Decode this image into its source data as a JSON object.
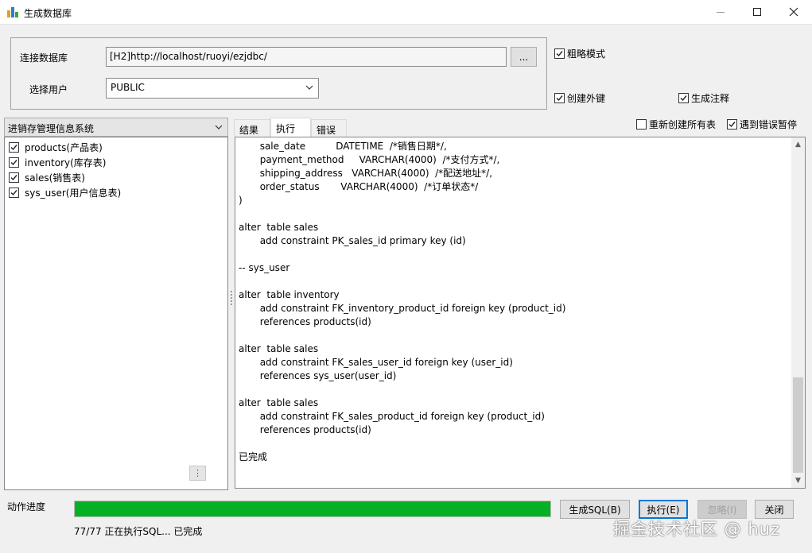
{
  "window": {
    "title": "生成数据库",
    "icon": "database-app-icon"
  },
  "connection": {
    "db_label": "连接数据库",
    "db_value": "[H2]http://localhost/ruoyi/ezjdbc/",
    "browse_label": "...",
    "user_label": "选择用户",
    "user_value": "PUBLIC"
  },
  "options": {
    "brief_mode": {
      "label": "粗略模式",
      "checked": true
    },
    "create_fk": {
      "label": "创建外键",
      "checked": true
    },
    "gen_comments": {
      "label": "生成注释",
      "checked": true
    },
    "recreate_all": {
      "label": "重新创建所有表",
      "checked": false
    },
    "pause_on_error": {
      "label": "遇到错误暂停",
      "checked": true
    }
  },
  "system_select": {
    "value": "进销存管理信息系统"
  },
  "tables": [
    {
      "label": "products(产品表)",
      "checked": true
    },
    {
      "label": "inventory(库存表)",
      "checked": true
    },
    {
      "label": "sales(销售表)",
      "checked": true
    },
    {
      "label": "sys_user(用户信息表)",
      "checked": true
    }
  ],
  "tree_menu_glyph": "⋮",
  "tabs": [
    {
      "label": "结果",
      "active": false
    },
    {
      "label": "执行",
      "active": true
    },
    {
      "label": "错误",
      "active": false
    }
  ],
  "output_text": "       sale_date          DATETIME  /*销售日期*/,\n       payment_method     VARCHAR(4000)  /*支付方式*/,\n       shipping_address   VARCHAR(4000)  /*配送地址*/,\n       order_status       VARCHAR(4000)  /*订单状态*/\n)\n\nalter  table sales\n       add constraint PK_sales_id primary key (id)\n\n-- sys_user\n\nalter  table inventory\n       add constraint FK_inventory_product_id foreign key (product_id)\n       references products(id)\n\nalter  table sales\n       add constraint FK_sales_user_id foreign key (user_id)\n       references sys_user(user_id)\n\nalter  table sales\n       add constraint FK_sales_product_id foreign key (product_id)\n       references products(id)\n\n已完成",
  "progress": {
    "label": "动作进度",
    "fraction": 1.0,
    "status_text": "77/77 正在执行SQL... 已完成",
    "color": "#06b025"
  },
  "buttons": {
    "generate_sql": "生成SQL(B)",
    "execute": "执行(E)",
    "ignore": "忽略(I)",
    "close": "关闭"
  },
  "watermark": "掘金技术社区 @ huz"
}
